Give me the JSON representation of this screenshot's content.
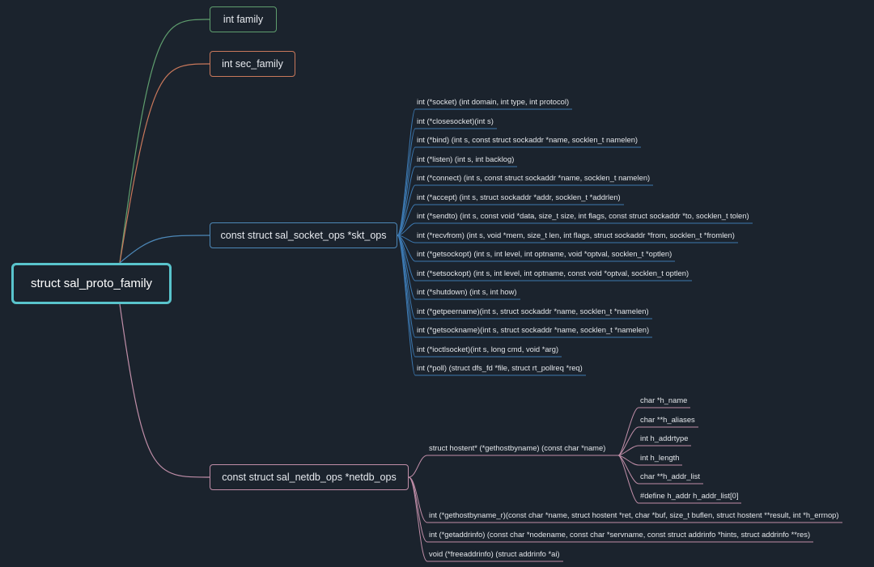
{
  "root": {
    "label": "struct sal_proto_family"
  },
  "family": {
    "label": "int family"
  },
  "sec_family": {
    "label": "int sec_family"
  },
  "skt_ops": {
    "label": "const struct sal_socket_ops *skt_ops",
    "items": [
      "int (*socket)      (int domain, int type, int protocol)",
      "int (*closesocket)(int s)",
      "int (*bind)        (int s, const struct sockaddr *name, socklen_t namelen)",
      "int (*listen)      (int s, int backlog)",
      "int (*connect)      (int s, const struct sockaddr *name, socklen_t namelen)",
      "int (*accept)      (int s, struct sockaddr *addr, socklen_t *addrlen)",
      "int (*sendto)      (int s, const void *data, size_t size, int flags, const struct sockaddr *to, socklen_t tolen)",
      "int (*recvfrom)    (int s, void *mem, size_t len, int flags, struct sockaddr *from, socklen_t *fromlen)",
      "int (*getsockopt) (int s, int level, int optname, void *optval, socklen_t *optlen)",
      "int (*setsockopt) (int s, int level, int optname, const void *optval, socklen_t optlen)",
      "int (*shutdown)    (int s, int how)",
      "int (*getpeername)(int s, struct sockaddr *name, socklen_t *namelen)",
      "int (*getsockname)(int s, struct sockaddr *name, socklen_t *namelen)",
      "int (*ioctlsocket)(int s, long cmd, void *arg)",
      "int (*poll)        (struct dfs_fd *file, struct rt_pollreq *req)"
    ]
  },
  "netdb_ops": {
    "label": "const struct sal_netdb_ops *netdb_ops",
    "gethostbyname": {
      "label": "struct hostent* (*gethostbyname)  (const char *name)",
      "fields": [
        "char  *h_name",
        "char **h_aliases",
        "int     h_addrtype",
        "int     h_length",
        "char **h_addr_list",
        "#define h_addr h_addr_list[0]"
      ]
    },
    "items": [
      "int  (*gethostbyname_r)(const char *name, struct hostent *ret, char *buf, size_t buflen, struct hostent **result, int *h_errnop)",
      "int  (*getaddrinfo)     (const char *nodename, const char *servname, const struct addrinfo *hints, struct addrinfo **res)",
      "void  (*freeaddrinfo)    (struct addrinfo *ai)"
    ]
  },
  "colors": {
    "background": "#1b232d",
    "root_border": "#59c4cc",
    "family": "#5f9e6e",
    "sec_family": "#c9785b",
    "skt_ops": "#4d88b8",
    "netdb_ops": "#c08ea8",
    "leaf_line": "#3c78b0"
  }
}
